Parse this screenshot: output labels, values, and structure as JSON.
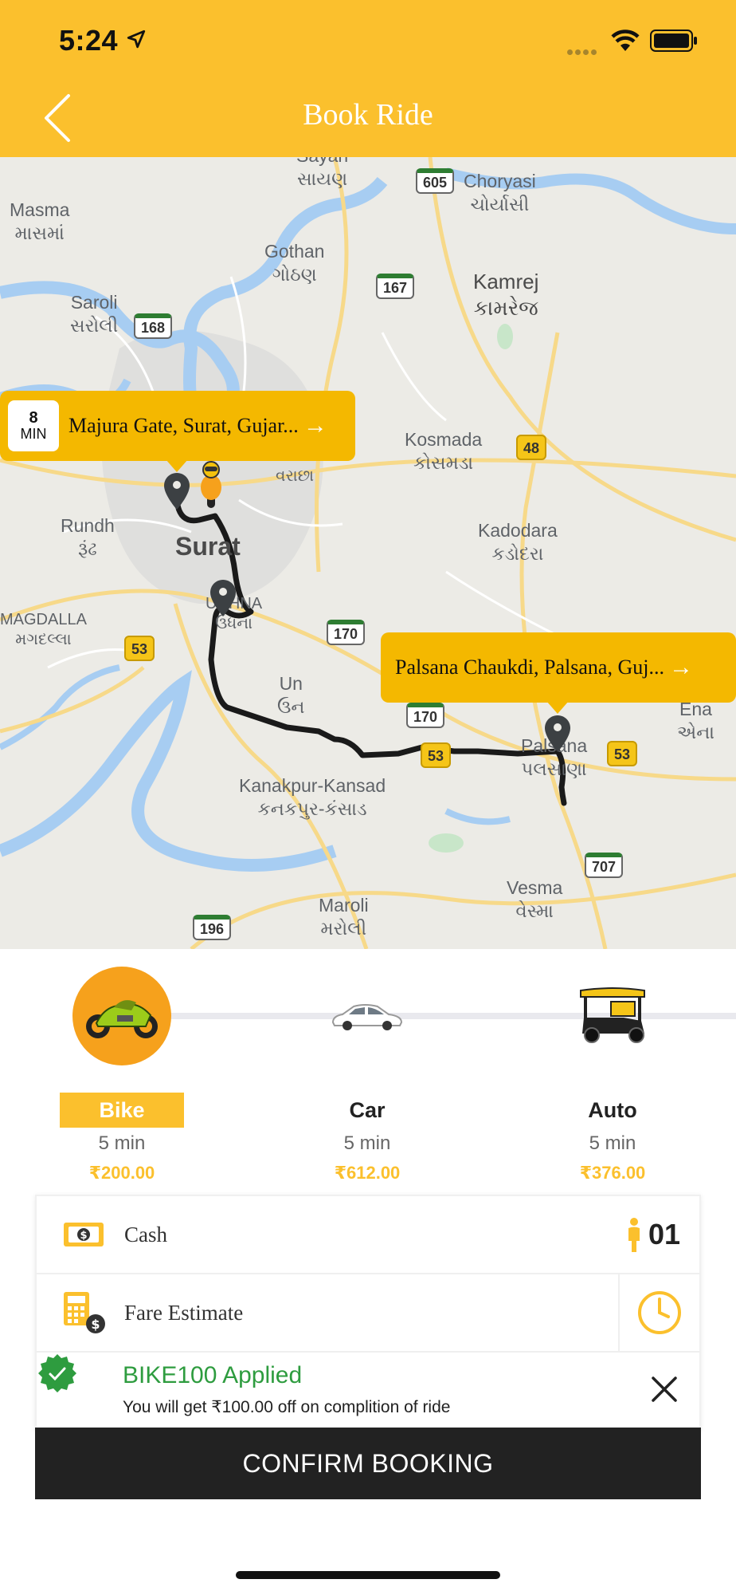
{
  "status_bar": {
    "time": "5:24"
  },
  "header": {
    "title": "Book Ride"
  },
  "map": {
    "places": [
      {
        "id": "sayan",
        "text": "Sayan\nસાયણ"
      },
      {
        "id": "choryasi",
        "text": "Choryasi\nચોર્યાસી"
      },
      {
        "id": "masma",
        "text": "Masma\nમાસમાં"
      },
      {
        "id": "gothan",
        "text": "Gothan\nગોઠણ"
      },
      {
        "id": "kamrej",
        "text": "Kamrej\nકામરેજ"
      },
      {
        "id": "saroli",
        "text": "Saroli\nસરોલી"
      },
      {
        "id": "kosmada",
        "text": "Kosmada\nકોસમડા"
      },
      {
        "id": "varachha",
        "text": "વરાછા"
      },
      {
        "id": "rundh",
        "text": "Rundh\nરૂંઢ"
      },
      {
        "id": "kadodara",
        "text": "Kadodara\nકડોદરા"
      },
      {
        "id": "udhna",
        "text": "UDHNA\nઉધના"
      },
      {
        "id": "magdalla",
        "text": "MAGDALLA\nમગદલ્લા"
      },
      {
        "id": "un",
        "text": "Un\nઉન"
      },
      {
        "id": "palsana",
        "text": "Palsana\nપલસાણા"
      },
      {
        "id": "ena",
        "text": "Ena\nએના"
      },
      {
        "id": "kanakpur",
        "text": "Kanakpur-Kansad\nકનકપુર-કંસાડ"
      },
      {
        "id": "vesma",
        "text": "Vesma\nવેસ્મા"
      },
      {
        "id": "maroli",
        "text": "Maroli\nમરોલી"
      }
    ],
    "city_label": "Surat",
    "highway_shields": [
      "605",
      "167",
      "168",
      "48",
      "170",
      "170",
      "53",
      "53",
      "53",
      "707",
      "196"
    ],
    "pickup": {
      "eta_value": "8",
      "eta_unit": "MIN",
      "address": "Majura Gate, Surat, Gujar..."
    },
    "dropoff": {
      "address": "Palsana Chaukdi, Palsana, Guj..."
    }
  },
  "vehicles": [
    {
      "name": "Bike",
      "time": "5 min",
      "price": "₹200.00",
      "selected": true,
      "icon": "motorbike-icon"
    },
    {
      "name": "Car",
      "time": "5 min",
      "price": "₹612.00",
      "selected": false,
      "icon": "car-icon"
    },
    {
      "name": "Auto",
      "time": "5 min",
      "price": "₹376.00",
      "selected": false,
      "icon": "auto-rickshaw-icon"
    }
  ],
  "payment": {
    "label": "Cash",
    "passenger_count": "01"
  },
  "fare": {
    "label": "Fare Estimate"
  },
  "coupon": {
    "title": "BIKE100 Applied",
    "description": "You will get ₹100.00 off on complition of ride"
  },
  "confirm_label": "CONFIRM BOOKING",
  "colors": {
    "primary": "#fbc02d",
    "bike_circle": "#f6a11c",
    "callout": "#f4b800",
    "success": "#2e9c3f",
    "button": "#222222"
  }
}
